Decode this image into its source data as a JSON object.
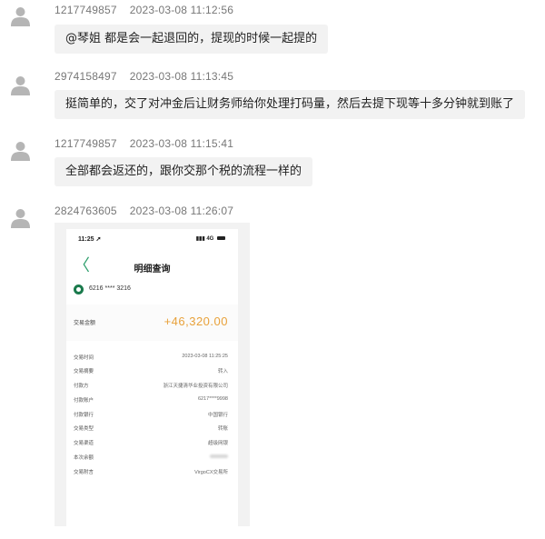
{
  "messages": [
    {
      "uid": "1217749857",
      "time": "2023-03-08 11:12:56",
      "text": "@琴姐 都是会一起退回的，提现的时候一起提的"
    },
    {
      "uid": "2974158497",
      "time": "2023-03-08 11:13:45",
      "text": "挺简单的，交了对冲金后让财务师给你处理打码量，然后去提下现等十多分钟就到账了"
    },
    {
      "uid": "1217749857",
      "time": "2023-03-08 11:15:41",
      "text": "全部都会返还的，跟你交那个税的流程一样的"
    },
    {
      "uid": "2824763605",
      "time": "2023-03-08 11:26:07",
      "text": ""
    }
  ],
  "icons": {
    "avatar": "user-silhouette-icon",
    "back": "chevron-left-icon",
    "bank": "bank-logo-icon"
  },
  "phone": {
    "status_time": "11:25 ➚",
    "status_right": "4G",
    "back_glyph": "〈",
    "title": "明细查询",
    "card_number": "6216 **** 3216",
    "amount_label": "交易金额",
    "amount": "+46,320.00",
    "details": [
      {
        "k": "交易时间",
        "v": "2023-03-08 11:25:25"
      },
      {
        "k": "交易摘要",
        "v": "转入"
      },
      {
        "k": "付款方",
        "v": "浙江天捷清华业投资有限公司"
      },
      {
        "k": "付款账户",
        "v": "6217****9998"
      },
      {
        "k": "付款银行",
        "v": "中国银行"
      },
      {
        "k": "交易类型",
        "v": "转账"
      },
      {
        "k": "交易渠道",
        "v": "超级网银"
      },
      {
        "k": "本次余额",
        "v": ""
      },
      {
        "k": "交易附言",
        "v": "VirgoCX交易所"
      }
    ],
    "colors": {
      "accent": "#2a9d6a",
      "amount": "#e8a13a"
    }
  }
}
